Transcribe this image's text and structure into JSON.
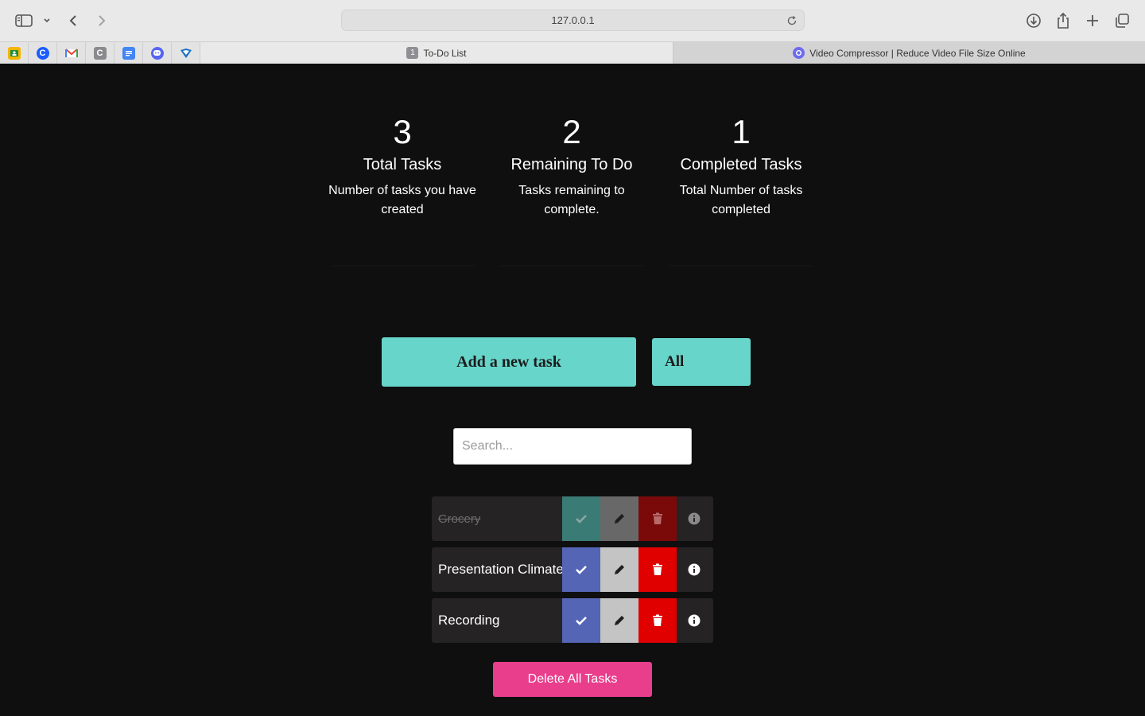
{
  "browser": {
    "url": "127.0.0.1",
    "tabs": [
      {
        "title": "To-Do List",
        "badge": "1",
        "active": true
      },
      {
        "title": "Video Compressor | Reduce Video File Size Online",
        "active": false
      }
    ],
    "bookmarks": [
      "google-classroom-icon",
      "chrome-c-icon",
      "gmail-icon",
      "c-gray-icon",
      "google-docs-icon",
      "discord-icon",
      "blue-app-icon"
    ]
  },
  "stats": [
    {
      "number": "3",
      "title": "Total Tasks",
      "desc": "Number of tasks you have created"
    },
    {
      "number": "2",
      "title": "Remaining To Do",
      "desc": "Tasks remaining to complete."
    },
    {
      "number": "1",
      "title": "Completed Tasks",
      "desc": "Total Number of tasks completed"
    }
  ],
  "controls": {
    "add_label": "Add a new task",
    "filter_label": "All",
    "search_placeholder": "Search...",
    "search_value": ""
  },
  "tasks": [
    {
      "name": "Grocery",
      "completed": true
    },
    {
      "name": "Presentation Climate",
      "completed": false
    },
    {
      "name": "Recording",
      "completed": false
    }
  ],
  "footer": {
    "delete_all_label": "Delete All Tasks"
  },
  "colors": {
    "accent": "#67d5c9",
    "check": "#5465b5",
    "delete": "#e00000",
    "delete_all": "#e83e8c",
    "background": "#0f0f0f"
  }
}
